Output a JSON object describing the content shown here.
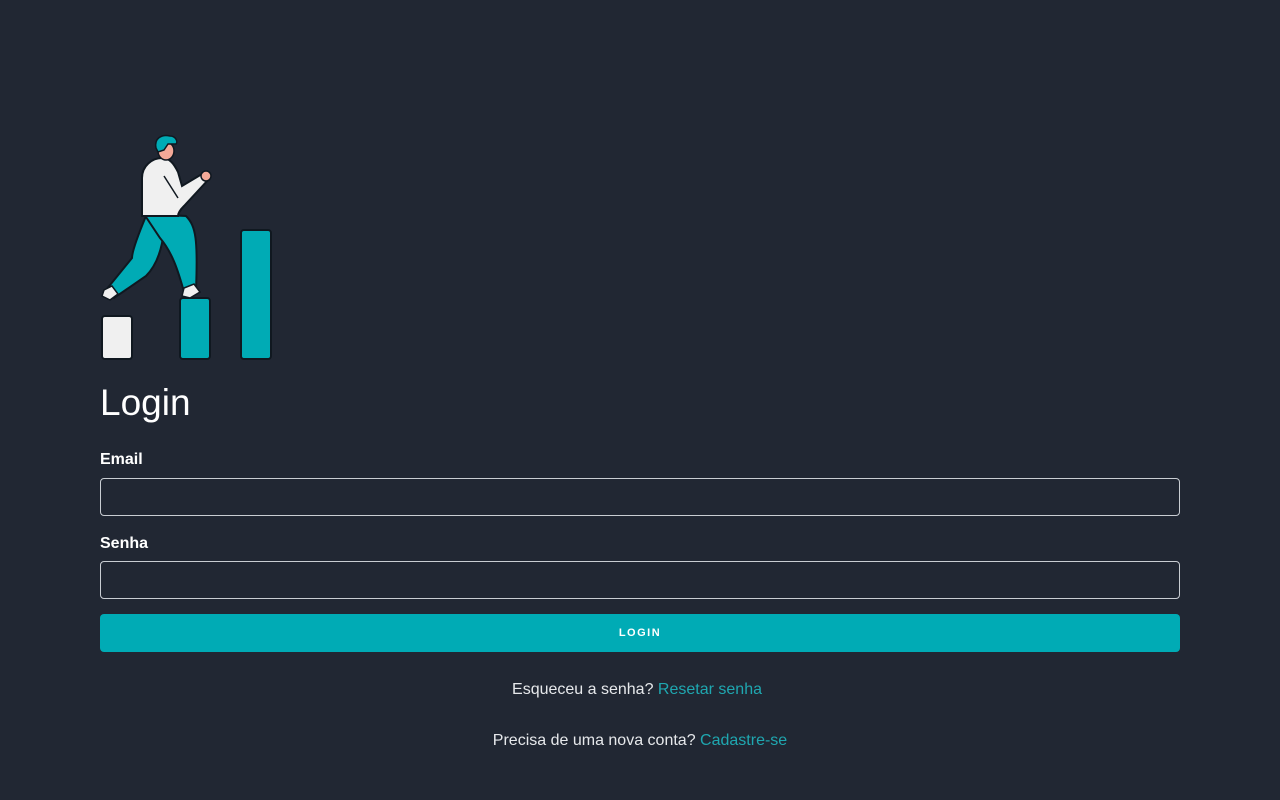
{
  "illustration": {
    "icon": "person-climbing-bars-illustration",
    "colors": {
      "accent": "#00abb5",
      "outline": "#101820",
      "light": "#f0f0f0",
      "skin": "#f4a998"
    }
  },
  "title": "Login",
  "form": {
    "email_label": "Email",
    "email_value": "",
    "password_label": "Senha",
    "password_value": "",
    "submit_label": "LOGIN"
  },
  "footer": {
    "forgot_text": "Esqueceu a senha?",
    "forgot_link": "Resetar senha",
    "signup_text": "Precisa de uma nova conta?",
    "signup_link": "Cadastre-se"
  },
  "colors": {
    "background": "#212733",
    "accent": "#00abb5",
    "link": "#1fa7b0"
  }
}
